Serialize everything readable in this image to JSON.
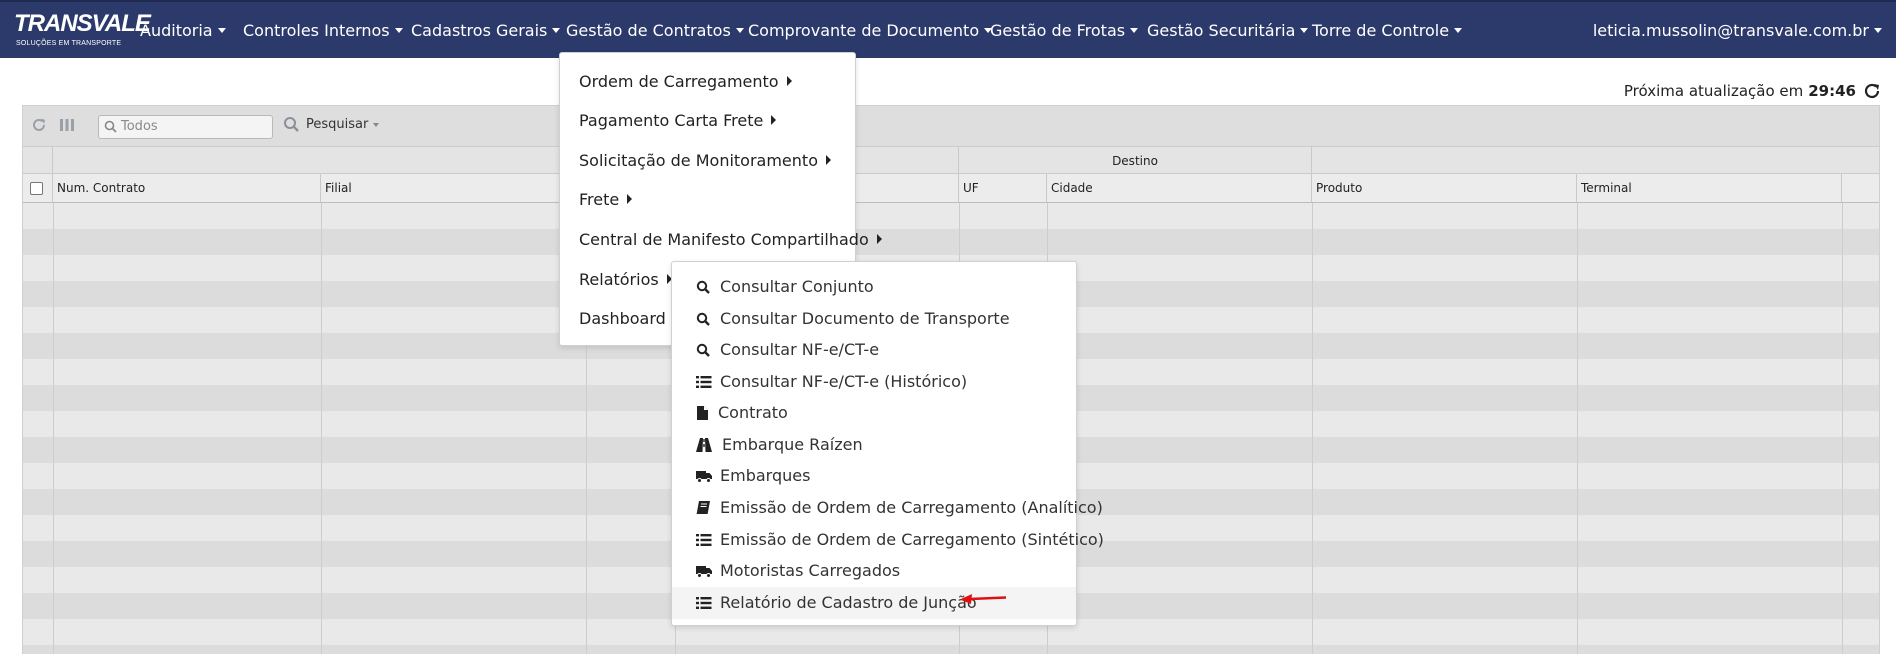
{
  "brand": {
    "logo_main": "TRANSVALE",
    "logo_tagline": "SOLUÇÕES EM TRANSPORTE"
  },
  "nav": {
    "items": [
      {
        "label": "Auditoria"
      },
      {
        "label": "Controles Internos"
      },
      {
        "label": "Cadastros Gerais"
      },
      {
        "label": "Gestão de Contratos"
      },
      {
        "label": "Comprovante de Documento"
      },
      {
        "label": "Gestão de Frotas"
      },
      {
        "label": "Gestão Securitária"
      },
      {
        "label": "Torre de Controle"
      }
    ],
    "user": "leticia.mussolin@transvale.com.br"
  },
  "refresh": {
    "label": "Próxima atualização em",
    "time": "29:46",
    "icon": "refresh-icon"
  },
  "grid": {
    "search_placeholder": "Todos",
    "search_button": "Pesquisar",
    "group_headers": {
      "destino": "Destino"
    },
    "columns": [
      {
        "label": "Num. Contrato"
      },
      {
        "label": "Filial"
      },
      {
        "label": ""
      },
      {
        "label": ""
      },
      {
        "label": "UF"
      },
      {
        "label": "Cidade"
      },
      {
        "label": "Produto"
      },
      {
        "label": "Terminal"
      },
      {
        "label": ""
      }
    ]
  },
  "gestao_menu": {
    "items": [
      {
        "label": "Ordem de Carregamento"
      },
      {
        "label": "Pagamento Carta Frete"
      },
      {
        "label": "Solicitação de Monitoramento"
      },
      {
        "label": "Frete"
      },
      {
        "label": "Central de Manifesto Compartilhado"
      },
      {
        "label": "Relatórios"
      },
      {
        "label": "Dashboard"
      }
    ]
  },
  "relatorios_menu": {
    "items": [
      {
        "label": "Consultar Conjunto",
        "icon": "search-icon"
      },
      {
        "label": "Consultar Documento de Transporte",
        "icon": "search-icon"
      },
      {
        "label": "Consultar NF-e/CT-e",
        "icon": "search-icon"
      },
      {
        "label": "Consultar NF-e/CT-e (Histórico)",
        "icon": "list-icon"
      },
      {
        "label": "Contrato",
        "icon": "file-icon"
      },
      {
        "label": "Embarque Raízen",
        "icon": "road-icon"
      },
      {
        "label": "Embarques",
        "icon": "truck-icon"
      },
      {
        "label": "Emissão de Ordem de Carregamento (Analítico)",
        "icon": "book-icon"
      },
      {
        "label": "Emissão de Ordem de Carregamento (Sintético)",
        "icon": "list-icon"
      },
      {
        "label": "Motoristas Carregados",
        "icon": "truck-icon"
      },
      {
        "label": "Relatório de Cadastro de Junção",
        "icon": "list-icon"
      }
    ]
  },
  "colors": {
    "navbar": "#2c3a6b",
    "annotation_arrow": "#e01010"
  }
}
